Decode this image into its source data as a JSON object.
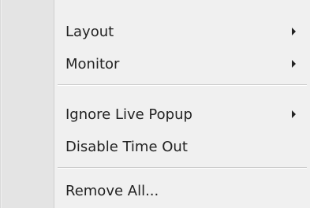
{
  "menu": {
    "groups": [
      {
        "items": [
          {
            "label": "Layout",
            "submenu": true
          },
          {
            "label": "Monitor",
            "submenu": true
          }
        ]
      },
      {
        "items": [
          {
            "label": "Ignore Live Popup",
            "submenu": true
          },
          {
            "label": "Disable Time Out",
            "submenu": false
          }
        ]
      },
      {
        "items": [
          {
            "label": "Remove All...",
            "submenu": false
          }
        ]
      }
    ]
  },
  "icons": {
    "submenu_arrow": "chevron-right-icon"
  },
  "colors": {
    "menu_bg": "#f0f0f0",
    "gutter_bg": "#e4e4e4",
    "text": "#222222",
    "separator": "#c8c8c8"
  }
}
